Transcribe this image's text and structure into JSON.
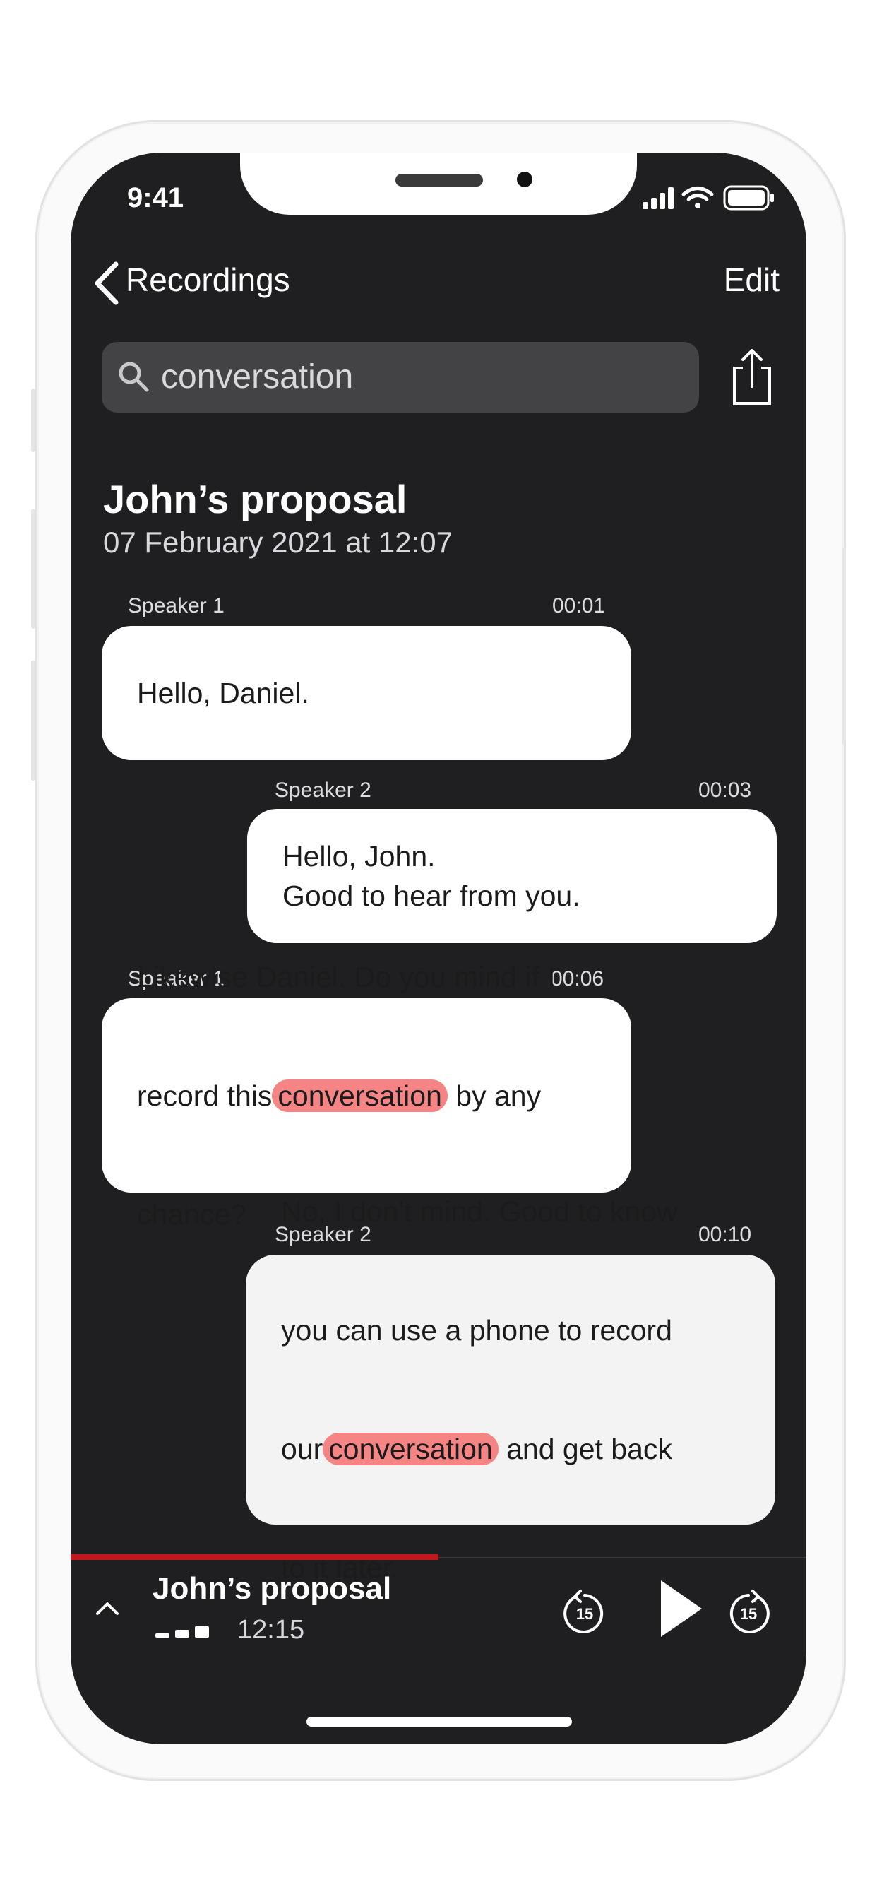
{
  "status_bar": {
    "time": "9:41"
  },
  "nav": {
    "back_label": "Recordings",
    "edit_label": "Edit"
  },
  "search": {
    "value": "conversation"
  },
  "recording": {
    "title": "John’s proposal",
    "date": "07 February 2021 at 12:07"
  },
  "messages": [
    {
      "speaker": "Speaker 1",
      "time": "00:01",
      "text": "Hello, Daniel."
    },
    {
      "speaker": "Speaker 2",
      "time": "00:03",
      "line1": "Hello, John.",
      "line2": "Good to hear from you."
    },
    {
      "speaker": "Speaker 1",
      "time": "00:06",
      "line1": "Likewise Daniel. Do you mind if I",
      "line2_pre": "record this",
      "highlight": "conversation",
      "line2_post": " by any",
      "line3": "chance?"
    },
    {
      "speaker": "Speaker 2",
      "time": "00:10",
      "line1": "No, I don't mind. Good to know",
      "line2": "you can use a phone to record",
      "line3_pre": "our",
      "highlight": "conversation",
      "line3_post": " and get back",
      "line4": "to it later."
    }
  ],
  "player": {
    "title": "John’s proposal",
    "time": "12:15",
    "progress": 0.5,
    "skip_back_label": "15",
    "skip_fwd_label": "15"
  },
  "colors": {
    "screen_bg": "#1f1f22",
    "highlight": "#f58584",
    "progress": "#c4161c",
    "bubble_selected": "#f3f3f3"
  }
}
